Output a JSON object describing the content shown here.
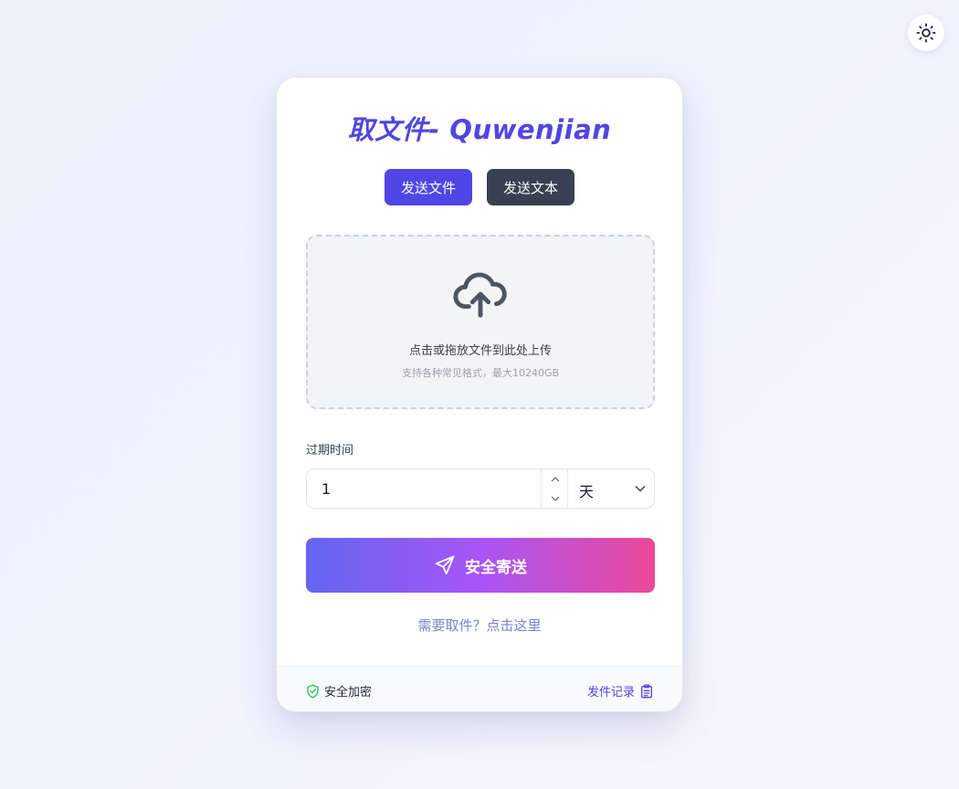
{
  "header": {
    "theme_toggle_icon": "sun-icon"
  },
  "card": {
    "title": "取文件- Quwenjian",
    "tabs": [
      {
        "label": "发送文件",
        "active": true
      },
      {
        "label": "发送文本",
        "active": false
      }
    ],
    "dropzone": {
      "icon": "cloud-upload-icon",
      "main_text": "点击或拖放文件到此处上传",
      "sub_text": "支持各种常见格式，最大10240GB"
    },
    "expiry": {
      "label": "过期时间",
      "value": "1",
      "unit": "天"
    },
    "send_button": {
      "label": "安全寄送",
      "icon": "paper-plane-icon"
    },
    "pickup_link": "需要取件？点击这里",
    "footer": {
      "secure_label": "安全加密",
      "history_label": "发件记录"
    }
  },
  "colors": {
    "primary": "#4f46e5",
    "dark_tab": "#374151",
    "gradient_start": "#6366f1",
    "gradient_mid": "#a855f7",
    "gradient_end": "#ec4899",
    "secure_green": "#22c55e"
  }
}
